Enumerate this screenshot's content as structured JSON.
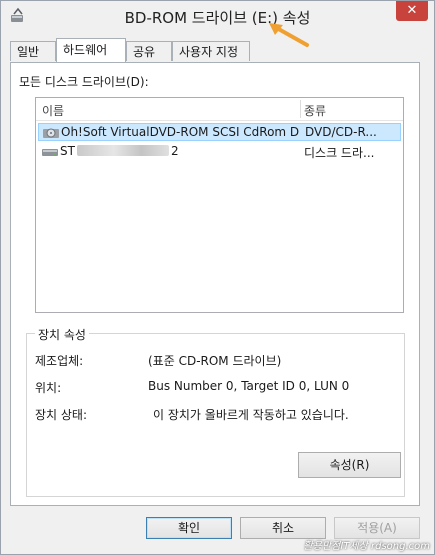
{
  "window": {
    "title": "BD-ROM 드라이브 (E:) 속성",
    "close_symbol": "✕"
  },
  "tabs": [
    "일반",
    "하드웨어",
    "공유",
    "사용자 지정"
  ],
  "active_tab": "하드웨어",
  "panel": {
    "all_drives_label": "모든 디스크 드라이브(D):",
    "columns": {
      "name": "이름",
      "type": "종류"
    },
    "rows": [
      {
        "name": "Oh!Soft VirtualDVD-ROM SCSI CdRom D...",
        "type": "DVD/CD-R...",
        "selected": true,
        "icon": "dvd-drive-icon"
      },
      {
        "name_prefix": "ST",
        "name_suffix": "2",
        "type": "디스크 드라...",
        "selected": false,
        "icon": "hard-disk-icon"
      }
    ]
  },
  "device_props": {
    "title": "장치 속성",
    "manufacturer_label": "제조업체:",
    "manufacturer_value": "(표준 CD-ROM 드라이브)",
    "location_label": "위치:",
    "location_value": "Bus Number 0, Target ID 0, LUN 0",
    "status_label": "장치 상태:",
    "status_value": "이 장치가 올바르게 작동하고 있습니다.",
    "properties_button": "속성(R)"
  },
  "buttons": {
    "ok": "확인",
    "cancel": "취소",
    "apply": "적용(A)"
  },
  "watermark": "활용만점IT세상 rdsong.com",
  "colors": {
    "selection": "#cce8ff",
    "arrow": "#f0a030",
    "close": "#c7433b"
  }
}
